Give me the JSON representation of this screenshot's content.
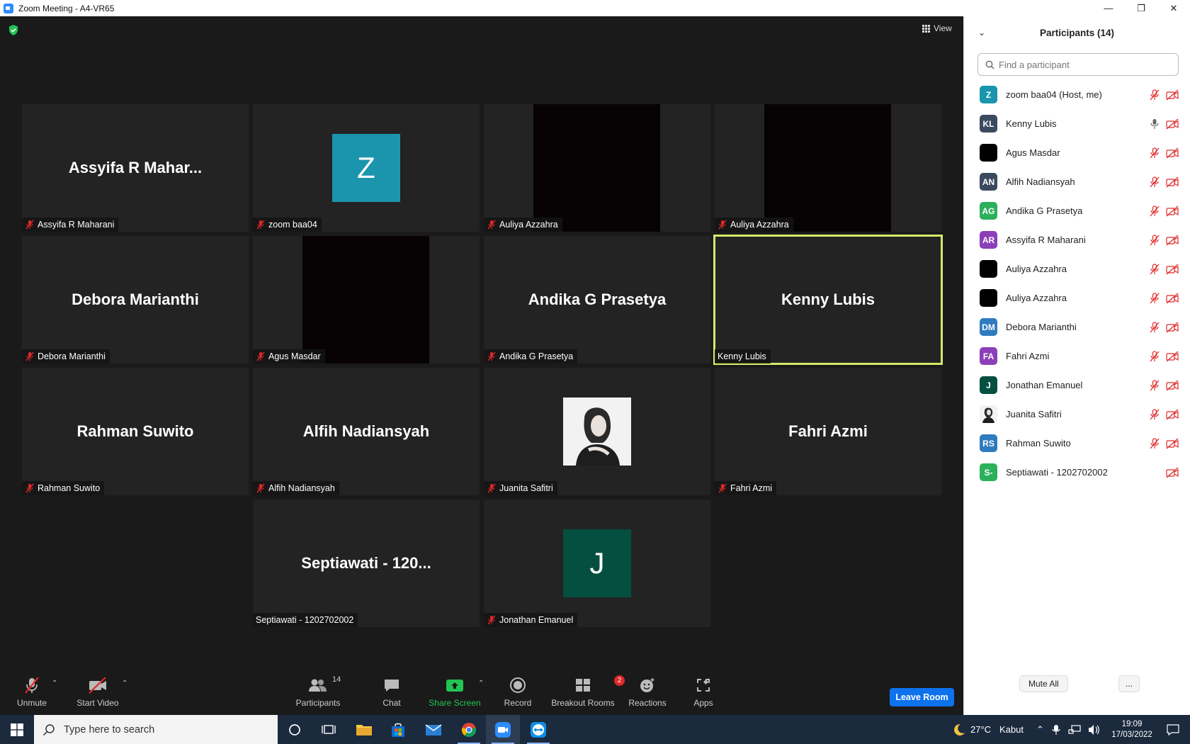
{
  "window": {
    "title": "Zoom Meeting - A4-VR65",
    "minimize": "—",
    "restore": "❐",
    "close": "✕"
  },
  "meeting": {
    "view_label": "View",
    "tiles": [
      {
        "display": "Assyifa  R  Mahar...",
        "label": "Assyifa R Maharani",
        "kind": "name",
        "muted": true
      },
      {
        "display": "Z",
        "label": "zoom baa04",
        "kind": "avatar",
        "color": "#1a95ad",
        "muted": true
      },
      {
        "display": "",
        "label": "Auliya Azzahra",
        "kind": "black",
        "muted": true
      },
      {
        "display": "",
        "label": "Auliya Azzahra",
        "kind": "black",
        "muted": true
      },
      {
        "display": "Debora Marianthi",
        "label": "Debora Marianthi",
        "kind": "name",
        "muted": true
      },
      {
        "display": "",
        "label": "Agus Masdar",
        "kind": "black",
        "muted": true
      },
      {
        "display": "Andika G Prasetya",
        "label": "Andika G Prasetya",
        "kind": "name",
        "muted": true
      },
      {
        "display": "Kenny Lubis",
        "label": "Kenny Lubis",
        "kind": "name",
        "muted": false,
        "active": true
      },
      {
        "display": "Rahman Suwito",
        "label": "Rahman Suwito",
        "kind": "name",
        "muted": true
      },
      {
        "display": "Alfih Nadiansyah",
        "label": "Alfih Nadiansyah",
        "kind": "name",
        "muted": true
      },
      {
        "display": "",
        "label": "Juanita Safitri",
        "kind": "photo",
        "muted": true
      },
      {
        "display": "Fahri Azmi",
        "label": "Fahri Azmi",
        "kind": "name",
        "muted": true
      },
      {
        "display": "Septiawati - 120...",
        "label": "Septiawati - 1202702002",
        "kind": "name",
        "muted": false
      },
      {
        "display": "J",
        "label": "Jonathan Emanuel",
        "kind": "avatar",
        "color": "#054f40",
        "muted": true
      }
    ]
  },
  "toolbar": {
    "unmute": "Unmute",
    "start_video": "Start Video",
    "participants": "Participants",
    "participants_count": "14",
    "chat": "Chat",
    "share_screen": "Share Screen",
    "record": "Record",
    "breakout_rooms": "Breakout Rooms",
    "breakout_badge": "2",
    "reactions": "Reactions",
    "apps": "Apps",
    "leave": "Leave Room"
  },
  "panel": {
    "title": "Participants (14)",
    "search_placeholder": "Find a participant",
    "mute_all": "Mute All",
    "more": "...",
    "participants": [
      {
        "initials": "Z",
        "name": "zoom baa04 (Host, me)",
        "color": "#1a95ad",
        "mic": "muted",
        "video": true
      },
      {
        "initials": "KL",
        "name": "Kenny Lubis",
        "color": "#3b4a5e",
        "mic": "on",
        "video": true
      },
      {
        "initials": "",
        "name": "Agus Masdar",
        "color": "#000000",
        "mic": "muted",
        "video": true
      },
      {
        "initials": "AN",
        "name": "Alfih Nadiansyah",
        "color": "#3b4a5e",
        "mic": "muted",
        "video": true
      },
      {
        "initials": "AG",
        "name": "Andika G Prasetya",
        "color": "#2cb05c",
        "mic": "muted",
        "video": true
      },
      {
        "initials": "AR",
        "name": "Assyifa R Maharani",
        "color": "#8b3fb8",
        "mic": "muted",
        "video": true
      },
      {
        "initials": "",
        "name": "Auliya Azzahra",
        "color": "#000000",
        "mic": "muted",
        "video": true
      },
      {
        "initials": "",
        "name": "Auliya Azzahra",
        "color": "#000000",
        "mic": "muted",
        "video": true
      },
      {
        "initials": "DM",
        "name": "Debora Marianthi",
        "color": "#2f7bbf",
        "mic": "muted",
        "video": true
      },
      {
        "initials": "FA",
        "name": "Fahri Azmi",
        "color": "#8b3fb8",
        "mic": "muted",
        "video": true
      },
      {
        "initials": "J",
        "name": "Jonathan Emanuel",
        "color": "#054f40",
        "mic": "muted",
        "video": true
      },
      {
        "initials": "",
        "name": "Juanita Safitri",
        "color": "photo",
        "mic": "muted",
        "video": true
      },
      {
        "initials": "RS",
        "name": "Rahman Suwito",
        "color": "#2f7bbf",
        "mic": "muted",
        "video": true
      },
      {
        "initials": "S-",
        "name": "Septiawati - 1202702002",
        "color": "#2cb05c",
        "mic": "none",
        "video": true
      }
    ]
  },
  "taskbar": {
    "search_placeholder": "Type here to search",
    "weather": "27°C",
    "weather_desc": "Kabut",
    "time": "19:09",
    "date": "17/03/2022"
  }
}
